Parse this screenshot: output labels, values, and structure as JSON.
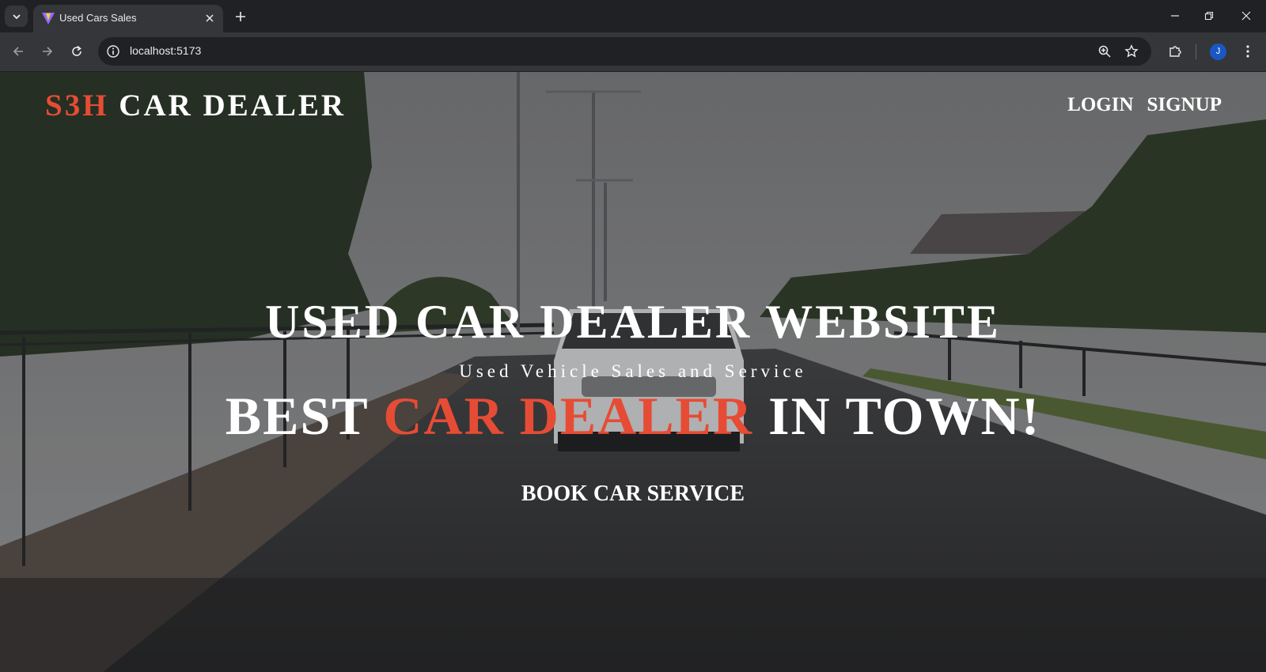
{
  "browser": {
    "tab": {
      "title": "Used Cars Sales"
    },
    "address_bar": {
      "url": "localhost:5173"
    },
    "profile": {
      "initial": "J"
    },
    "icons": {
      "tab_menu": "chevron-down-icon",
      "favicon": "vite-icon",
      "tab_close": "close-icon",
      "new_tab": "plus-icon",
      "back": "arrow-left-icon",
      "forward": "arrow-right-icon",
      "reload": "reload-icon",
      "site_info": "info-icon",
      "zoom": "zoom-icon",
      "bookmark": "star-icon",
      "extensions": "puzzle-icon",
      "menu": "more-vert-icon",
      "minimize": "minimize-icon",
      "restore": "restore-icon",
      "close_window": "close-icon"
    }
  },
  "site": {
    "logo": {
      "accent": "S3H",
      "rest": "CAR DEALER"
    },
    "nav": {
      "login": "LOGIN",
      "signup": "SIGNUP"
    },
    "hero": {
      "title": "USED CAR DEALER WEBSITE",
      "subtitle": "Used Vehicle Sales and Service",
      "tagline_before": "BEST",
      "tagline_accent": "CAR DEALER",
      "tagline_after": "IN TOWN!",
      "cta": "BOOK CAR SERVICE"
    }
  },
  "colors": {
    "accent": "#e64c35",
    "text": "#ffffff",
    "chrome_dark": "#202124",
    "chrome_toolbar": "#35363a",
    "avatar": "#1a57c4"
  }
}
